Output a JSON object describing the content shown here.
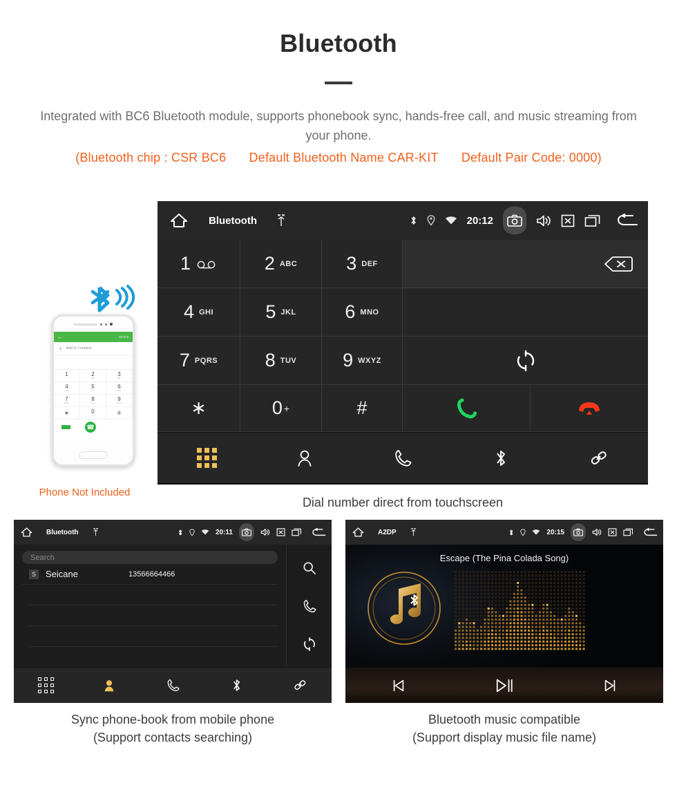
{
  "header": {
    "title": "Bluetooth",
    "description": "Integrated with BC6 Bluetooth module, supports phonebook sync, hands-free call, and music streaming from your phone.",
    "spec_chip": "(Bluetooth chip : CSR BC6",
    "spec_name": "Default Bluetooth Name CAR-KIT",
    "spec_pair": "Default Pair Code: 0000)",
    "accent_color": "#f4601c",
    "text_color": "#6e6e6e"
  },
  "phone_mockup": {
    "header_back": "←",
    "header_more": "MORE",
    "add_contacts_plus": "+",
    "add_contacts_label": "Add to Contacts",
    "keys": [
      {
        "num": "1",
        "sub": "∞"
      },
      {
        "num": "2",
        "sub": "ABC"
      },
      {
        "num": "3",
        "sub": "DEF"
      },
      {
        "num": "4",
        "sub": "GHI"
      },
      {
        "num": "5",
        "sub": "JKL"
      },
      {
        "num": "6",
        "sub": "MNO"
      },
      {
        "num": "7",
        "sub": "PQRS"
      },
      {
        "num": "8",
        "sub": "TUV"
      },
      {
        "num": "9",
        "sub": "WXYZ"
      },
      {
        "num": "∗",
        "sub": ""
      },
      {
        "num": "0",
        "sub": "+"
      },
      {
        "num": "#",
        "sub": ""
      }
    ],
    "note": "Phone Not Included",
    "note_color": "#f4601c",
    "bluetooth_logo_color": "#1e9cd7"
  },
  "dialer_screen": {
    "statusbar": {
      "home_icon": "home-icon",
      "title": "Bluetooth",
      "usb_icon": "usb-icon",
      "bluetooth_icon": "bluetooth-icon",
      "location_icon": "location-icon",
      "wifi_icon": "wifi-icon",
      "time": "20:12",
      "camera_icon": "camera-icon",
      "volume_icon": "volume-icon",
      "close-box_icon": "close-box-icon",
      "recents_icon": "recents-icon",
      "back_icon": "back-icon"
    },
    "keys": [
      {
        "num": "1",
        "sub": "",
        "voicemail": true
      },
      {
        "num": "2",
        "sub": "ABC"
      },
      {
        "num": "3",
        "sub": "DEF"
      },
      {
        "num": "4",
        "sub": "GHI"
      },
      {
        "num": "5",
        "sub": "JKL"
      },
      {
        "num": "6",
        "sub": "MNO"
      },
      {
        "num": "7",
        "sub": "PQRS"
      },
      {
        "num": "8",
        "sub": "TUV"
      },
      {
        "num": "9",
        "sub": "WXYZ"
      },
      {
        "num": "∗",
        "sub": ""
      },
      {
        "num": "0",
        "sub": "+"
      },
      {
        "num": "#",
        "sub": ""
      }
    ],
    "actions": {
      "backspace_icon": "backspace-icon",
      "sync_icon": "sync-icon",
      "call_icon": "call-icon",
      "hangup_icon": "hangup-icon",
      "call_color": "#1ed760",
      "hangup_color": "#f3391a"
    },
    "navbar": {
      "dialpad_icon": "dialpad-icon",
      "contacts_icon": "contacts-icon",
      "calllog_icon": "call-log-icon",
      "bluetooth_icon": "bluetooth-icon",
      "link_icon": "link-icon",
      "active": "dialpad",
      "active_color": "#f0c05a"
    },
    "caption": "Dial number direct from touchscreen"
  },
  "phonebook_screen": {
    "statusbar": {
      "title": "Bluetooth",
      "time": "20:11"
    },
    "search": {
      "placeholder": "Search",
      "value": ""
    },
    "contacts": [
      {
        "initial": "S",
        "name": "Seicane",
        "number": "13566664466"
      }
    ],
    "empty_rows": 3,
    "side_actions": {
      "search_icon": "search-icon",
      "call_icon": "call-icon",
      "sync_icon": "sync-icon"
    },
    "navbar": {
      "active": "contacts",
      "active_color": "#f0c05a"
    },
    "caption_line1": "Sync phone-book from mobile phone",
    "caption_line2": "(Support contacts searching)"
  },
  "music_screen": {
    "statusbar": {
      "title": "A2DP",
      "time": "20:15"
    },
    "track_title": "Escape (The Pina Colada Song)",
    "album_art_icon": "music-note-bluetooth-icon",
    "equalizer_icon": "dot-matrix-equalizer",
    "accent_color": "#c8912f",
    "controls": {
      "prev_icon": "skip-previous-icon",
      "playpause_icon": "play-pause-icon",
      "next_icon": "skip-next-icon"
    },
    "caption_line1": "Bluetooth music compatible",
    "caption_line2": "(Support display music file name)"
  }
}
